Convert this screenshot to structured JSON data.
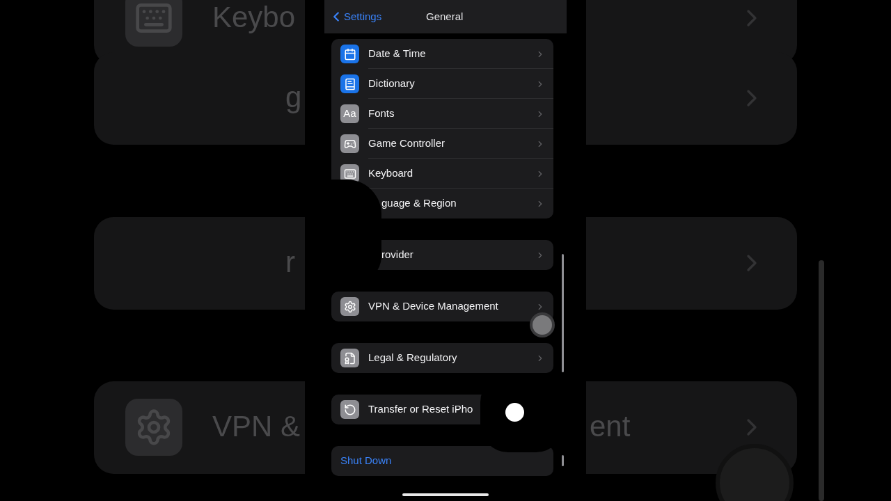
{
  "backdrop": [
    {
      "texts": [
        "Keybo"
      ],
      "kind": "keyboard"
    },
    {
      "texts": [
        "g"
      ],
      "kind": "plain"
    },
    {
      "texts": [
        "r"
      ],
      "kind": "plain"
    },
    {
      "texts": [
        "VPN &",
        "ent"
      ],
      "kind": "gear"
    }
  ],
  "nav": {
    "back": "Settings",
    "title": "General"
  },
  "groups": [
    {
      "rows": [
        {
          "label": "Date & Time",
          "kind": "calendar",
          "color": "#1a73e8"
        },
        {
          "label": "Dictionary",
          "kind": "book",
          "color": "#1a73e8"
        },
        {
          "label": "Fonts",
          "kind": "text",
          "icon_text": "Aa",
          "color": "#8e8e93"
        },
        {
          "label": "Game Controller",
          "kind": "gamepad",
          "color": "#8e8e93"
        },
        {
          "label": "Keyboard",
          "kind": "keyboard",
          "color": "#8e8e93"
        },
        {
          "label": "guage & Region",
          "kind": "covered"
        }
      ]
    },
    {
      "rows": [
        {
          "label": "rovider",
          "kind": "covered"
        }
      ]
    },
    {
      "rows": [
        {
          "label": "VPN & Device Management",
          "kind": "gear",
          "color": "#8e8e93"
        }
      ]
    },
    {
      "rows": [
        {
          "label": "Legal & Regulatory",
          "kind": "document",
          "color": "#8e8e93"
        }
      ]
    },
    {
      "rows": [
        {
          "label": "Transfer or Reset iPho",
          "kind": "reset",
          "color": "#8e8e93"
        }
      ]
    },
    {
      "rows": [
        {
          "label": "Shut Down",
          "kind": "action"
        }
      ]
    }
  ]
}
